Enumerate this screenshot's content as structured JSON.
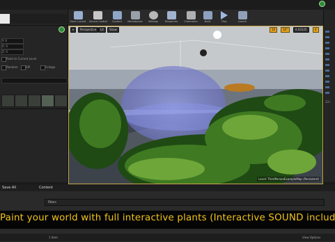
{
  "toolbar": {
    "buttons": [
      {
        "label": "Save Current",
        "icon": "save-icon"
      },
      {
        "label": "Source Control",
        "icon": "source-control-icon"
      },
      {
        "label": "Content",
        "icon": "content-icon"
      },
      {
        "label": "Marketplace",
        "icon": "marketplace-icon"
      },
      {
        "label": "Settings",
        "icon": "settings-icon"
      },
      {
        "label": "Blueprints",
        "icon": "blueprints-icon"
      },
      {
        "label": "Cinematics",
        "icon": "cinematics-icon"
      },
      {
        "label": "Build",
        "icon": "build-icon"
      },
      {
        "label": "Play",
        "icon": "play-icon"
      },
      {
        "label": "Launch",
        "icon": "launch-icon"
      }
    ]
  },
  "viewport": {
    "perspective_label": "Perspective",
    "lit_label": "Lit",
    "show_label": "Show",
    "grid_value": "10",
    "rotation_value": "10°",
    "scale_value": "0.03125",
    "camera_value": "4",
    "level_label": "Level: ThirdPersonExampleMap (Persistent)"
  },
  "left_panel": {
    "fields": [
      "Y: 0",
      "X: 0",
      "Z: 0"
    ],
    "checkbox_labels": [
      "Paint to Current Level",
      "Random",
      "EIP",
      "Foliage"
    ]
  },
  "content_browser": {
    "save_all_label": "Save All",
    "content_label": "Content",
    "filters_label": "Filters",
    "items_label": "1 item",
    "view_options_label": "View Options"
  },
  "right_panel": {
    "items_label": "13 i"
  },
  "banner": {
    "text": "Paint your world with full interactive plants (Interactive SOUND included)"
  },
  "colors": {
    "banner_text": "#f0c419",
    "viewport_border": "#c8a64a",
    "accent_green": "#2f8a3a"
  }
}
